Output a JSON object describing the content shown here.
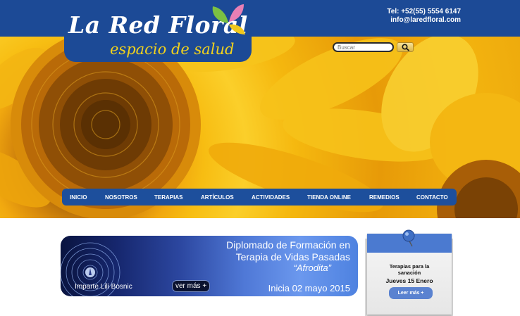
{
  "header": {
    "logo_title": "La Red Floral",
    "logo_subtitle": "espacio de salud",
    "phone": "Tel: +52(55) 5554 6147",
    "email": "info@laredfloral.com"
  },
  "search": {
    "placeholder": "Buscar"
  },
  "nav": {
    "items": [
      {
        "label": "INICIO"
      },
      {
        "label": "NOSOTROS"
      },
      {
        "label": "TERAPIAS"
      },
      {
        "label": "ARTÍCULOS"
      },
      {
        "label": "ACTIVIDADES"
      },
      {
        "label": "TIENDA ONLINE"
      },
      {
        "label": "REMEDIOS"
      },
      {
        "label": "CONTACTO"
      }
    ]
  },
  "banner": {
    "title_line1": "Diplomado de Formación en",
    "title_line2": "Terapia de Vidas Pasadas",
    "title_line3": "“Afrodita”",
    "instructor": "Imparte Lili Bosnic",
    "more_label": "ver más +",
    "start_date": "Inicia 02 mayo 2015"
  },
  "note": {
    "title_line1": "Terapias para la",
    "title_line2": "sanación",
    "date": "Jueves 15 Enero",
    "button_label": "Leer más +"
  },
  "colors": {
    "brand_blue": "#1c4a96",
    "logo_yellow": "#f2d21c",
    "note_blue": "#4b7ad0"
  }
}
